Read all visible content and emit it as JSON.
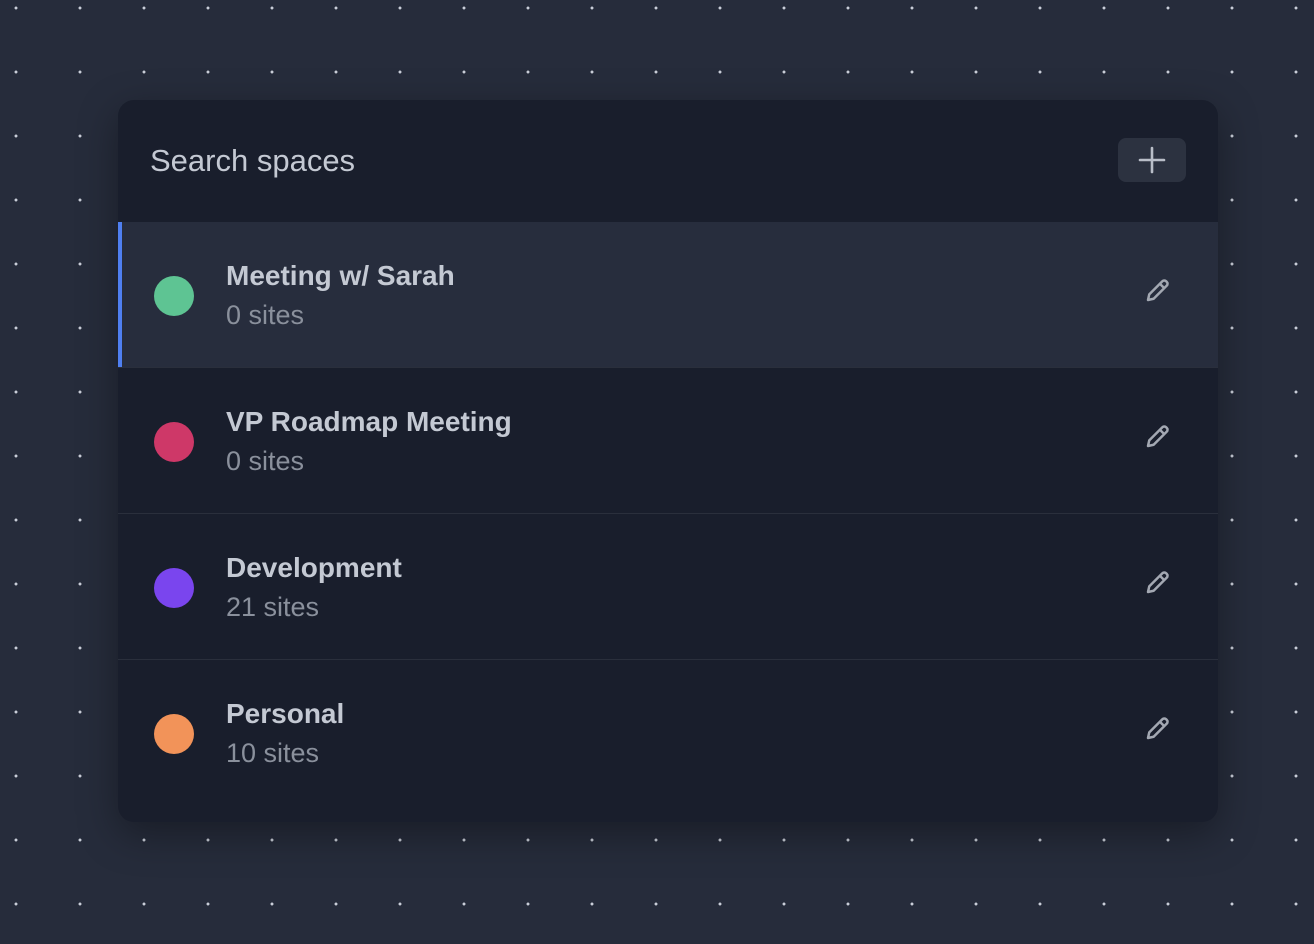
{
  "search": {
    "placeholder": "Search spaces"
  },
  "header": {
    "add_icon": "plus-icon"
  },
  "spaces": [
    {
      "name": "Meeting w/ Sarah",
      "count": "0 sites",
      "color": "#5ec493",
      "active": true,
      "edit_icon": "pencil-icon"
    },
    {
      "name": "VP Roadmap Meeting",
      "count": "0 sites",
      "color": "#ce3868",
      "active": false,
      "edit_icon": "pencil-icon"
    },
    {
      "name": "Development",
      "count": "21 sites",
      "color": "#7a45ee",
      "active": false,
      "edit_icon": "pencil-icon"
    },
    {
      "name": "Personal",
      "count": "10 sites",
      "color": "#f29359",
      "active": false,
      "edit_icon": "pencil-icon"
    }
  ],
  "colors": {
    "background": "#262c3b",
    "panel": "#191e2c",
    "active_row": "#272d3d",
    "active_indicator": "#4f7ff0"
  }
}
